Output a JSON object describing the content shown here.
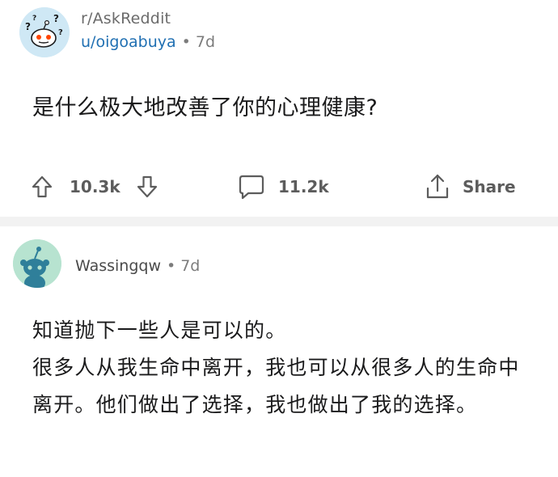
{
  "post": {
    "subreddit": "r/AskReddit",
    "author": "u/oigoabuya",
    "separator_dot": "•",
    "age": "7d",
    "title": "是什么极大地改善了你的心理健康?",
    "score": "10.3k",
    "comment_count": "11.2k",
    "share_label": "Share",
    "avatar_icon": "confused-snoo-icon"
  },
  "comment": {
    "author": "Wassingqw",
    "separator_dot": "•",
    "age": "7d",
    "avatar_icon": "snoo-icon",
    "paragraphs": [
      "知道抛下一些人是可以的。",
      "很多人从我生命中离开，我也可以从很多人的生命中离开。他们做出了选择，我也做出了我的选择。"
    ]
  },
  "colors": {
    "link_blue": "#1f6fb2",
    "muted_gray": "#7c7c7c",
    "icon_gray": "#5c5c5c",
    "separator": "#f2f2f2",
    "post_avatar_bg": "#cfe8f5",
    "comment_avatar_bg": "#b7e3d0"
  }
}
